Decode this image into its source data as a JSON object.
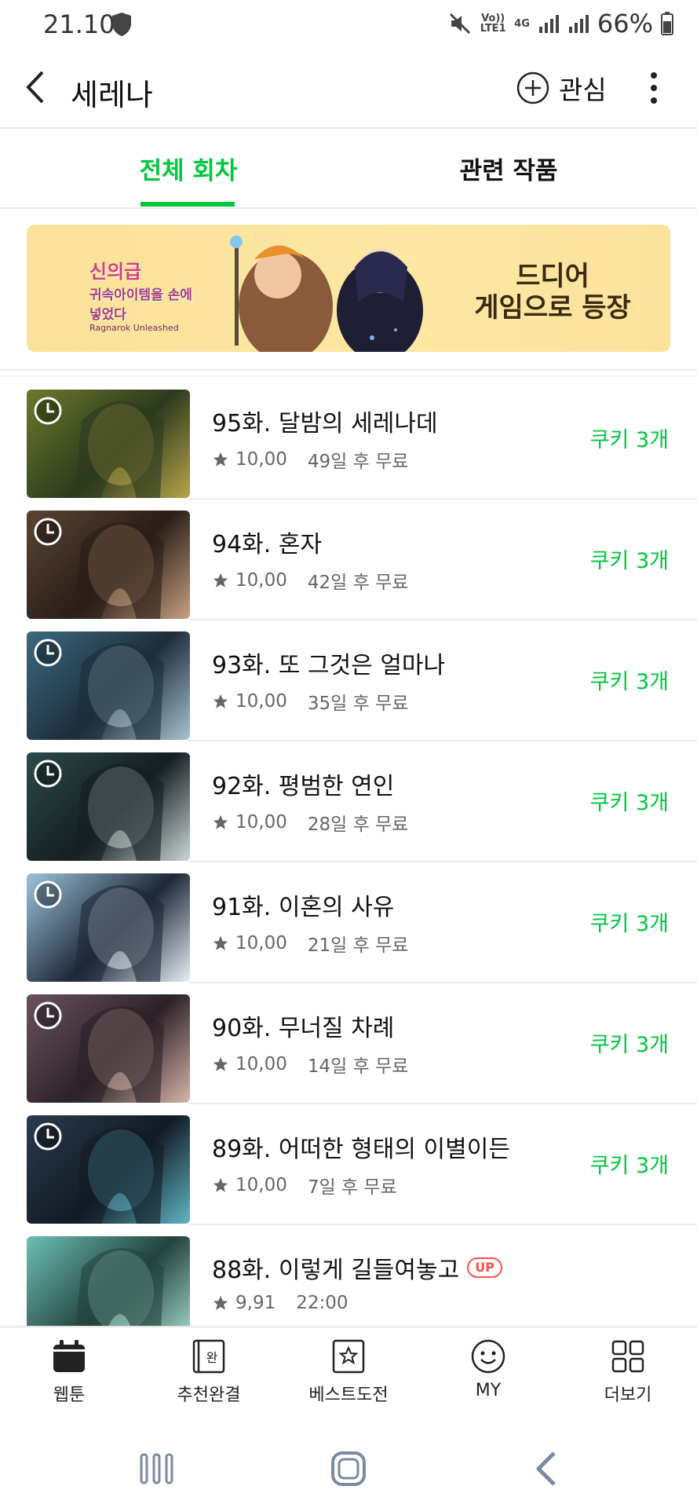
{
  "status": {
    "time": "21.10",
    "battery": "66%",
    "volte": "Vo)) LTE1",
    "net": "4G"
  },
  "header": {
    "title": "세레나",
    "interest_label": "관심"
  },
  "tabs": [
    {
      "label": "전체 회차",
      "active": true
    },
    {
      "label": "관련 작품",
      "active": false
    }
  ],
  "banner": {
    "logo_line1": "신의급",
    "logo_line2": "귀속아이템을 손에넣었다",
    "logo_line3": "Ragnarok Unleashed",
    "text_line1": "드디어",
    "text_line2": "게임으로 등장"
  },
  "episodes": [
    {
      "title": "95화. 달밤의 세레나데",
      "rating": "10,00",
      "free_in": "49일 후 무료",
      "price": "쿠키 3개",
      "thumb_colors": [
        "#6b7a2a",
        "#2c3a1e",
        "#b8a44a"
      ]
    },
    {
      "title": "94화. 혼자",
      "rating": "10,00",
      "free_in": "42일 후 무료",
      "price": "쿠키 3개",
      "thumb_colors": [
        "#5a4434",
        "#2a1e18",
        "#c9a080"
      ]
    },
    {
      "title": "93화. 또 그것은 얼마나",
      "rating": "10,00",
      "free_in": "35일 후 무료",
      "price": "쿠키 3개",
      "thumb_colors": [
        "#3d6a80",
        "#1d2d3b",
        "#a9c2cf"
      ]
    },
    {
      "title": "92화. 평범한 연인",
      "rating": "10,00",
      "free_in": "28일 후 무료",
      "price": "쿠키 3개",
      "thumb_colors": [
        "#2c4a4a",
        "#151e22",
        "#cbd6d6"
      ]
    },
    {
      "title": "91화. 이혼의 사유",
      "rating": "10,00",
      "free_in": "21일 후 무료",
      "price": "쿠키 3개",
      "thumb_colors": [
        "#9cc4dc",
        "#1e2838",
        "#e6eef4"
      ]
    },
    {
      "title": "90화. 무너질 차례",
      "rating": "10,00",
      "free_in": "14일 후 무료",
      "price": "쿠키 3개",
      "thumb_colors": [
        "#6a5360",
        "#2c2228",
        "#d7b4a8"
      ]
    },
    {
      "title": "89화. 어떠한 형태의 이별이든",
      "rating": "10,00",
      "free_in": "7일 후 무료",
      "price": "쿠키 3개",
      "thumb_colors": [
        "#2b3c4e",
        "#121a24",
        "#5fb6c6"
      ]
    },
    {
      "title": "88화. 이렇게 길들여놓고",
      "rating": "9,91",
      "free_in": "22:00",
      "price": "",
      "badge": "UP",
      "thumb_colors": [
        "#6cc0b4",
        "#23423e",
        "#a9e0d2"
      ]
    }
  ],
  "bottom_nav": [
    {
      "label": "웹툰",
      "icon": "calendar-icon"
    },
    {
      "label": "추천완결",
      "icon": "book-complete-icon",
      "glyph": "완"
    },
    {
      "label": "베스트도전",
      "icon": "star-box-icon"
    },
    {
      "label": "MY",
      "icon": "smiley-icon"
    },
    {
      "label": "더보기",
      "icon": "grid-icon"
    }
  ],
  "colors": {
    "accent": "#00c73c",
    "up": "#ff4e4e"
  }
}
